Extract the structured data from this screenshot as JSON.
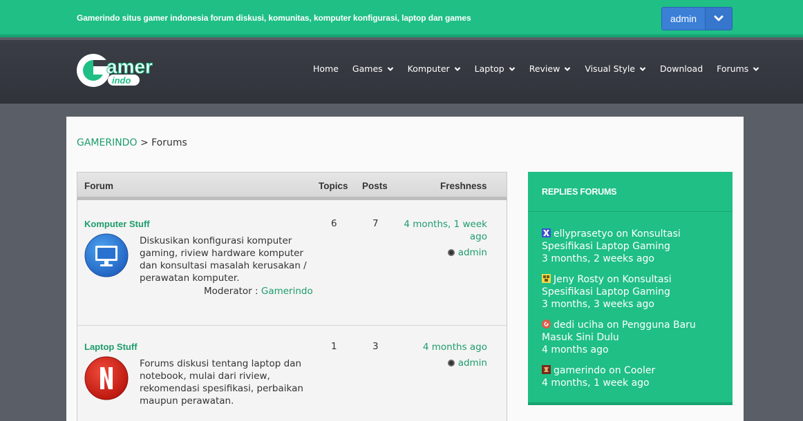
{
  "topbar": {
    "tagline": "Gamerindo situs gamer indonesia forum diskusi, komunitas, komputer konfigurasi, laptop dan games",
    "user_button": "admin",
    "bg_color": "#1fbf86"
  },
  "header": {
    "logo_main": "Gamer",
    "logo_sub": "indo",
    "nav": [
      {
        "label": "Home",
        "has_dropdown": false
      },
      {
        "label": "Games",
        "has_dropdown": true
      },
      {
        "label": "Komputer",
        "has_dropdown": true
      },
      {
        "label": "Laptop",
        "has_dropdown": true
      },
      {
        "label": "Review",
        "has_dropdown": true
      },
      {
        "label": "Visual Style",
        "has_dropdown": true
      },
      {
        "label": "Download",
        "has_dropdown": false
      },
      {
        "label": "Forums",
        "has_dropdown": true
      }
    ]
  },
  "breadcrumb": {
    "home": "GAMERINDO",
    "separator": ">",
    "current": "Forums"
  },
  "table": {
    "headers": {
      "forum": "Forum",
      "topics": "Topics",
      "posts": "Posts",
      "freshness": "Freshness"
    },
    "rows": [
      {
        "title": "Komputer Stuff",
        "icon": "monitor-icon",
        "description": "Diskusikan konfigurasi komputer gaming, riview hardware komputer dan konsultasi masalah kerusakan / perawatan komputer.",
        "moderator_label": "Moderator :",
        "moderator": "Gamerindo",
        "topics": "6",
        "posts": "7",
        "freshness": "4 months, 1 week ago",
        "last_user": "admin"
      },
      {
        "title": "Laptop Stuff",
        "icon": "netflix-n-icon",
        "description": "Forums diskusi tentang laptop dan notebook, mulai dari riview, rekomendasi spesifikasi, perbaikan maupun perawatan.",
        "topics": "1",
        "posts": "3",
        "freshness": "4 months ago",
        "last_user": "admin"
      }
    ]
  },
  "sidebar": {
    "title": "REPLIES FORUMS",
    "replies": [
      {
        "user": "ellyprasetyo",
        "on": "on",
        "topic": "Konsultasi Spesifikasi Laptop Gaming",
        "time": "3 months, 2 weeks ago",
        "avatar_color": "#3a4fd0"
      },
      {
        "user": "Jeny Rosty",
        "on": "on",
        "topic": "Konsultasi Spesifikasi Laptop Gaming",
        "time": "3 months, 3 weeks ago",
        "avatar_color": "#8a7a1a"
      },
      {
        "user": "dedi uciha",
        "on": "on",
        "topic": "Pengguna Baru Masuk Sini Dulu",
        "time": "4 months ago",
        "avatar_color": "#e05a4a"
      },
      {
        "user": "gamerindo",
        "on": "on",
        "topic": "Cooler",
        "time": "4 months, 1 week ago",
        "avatar_color": "#7a2a1a"
      }
    ]
  }
}
